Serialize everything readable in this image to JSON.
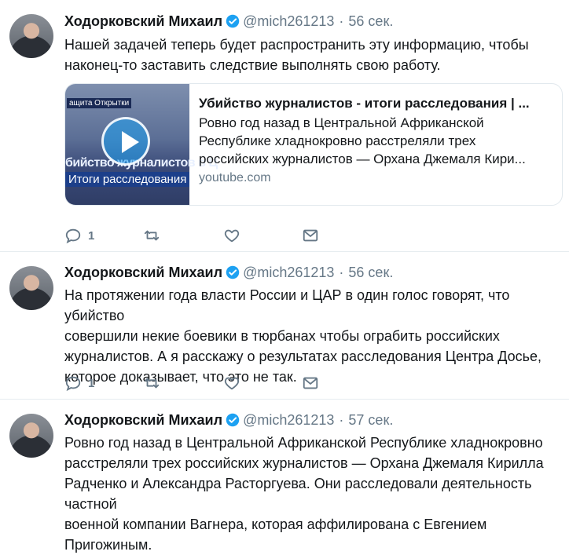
{
  "author": {
    "name": "Ходорковский Михаил",
    "handle": "@mich261213"
  },
  "tweets": [
    {
      "time": "56 сек.",
      "lines": [
        "Нашей задачей теперь будет распространить эту информацию, чтобы",
        "наконец-то заставить следствие выполнять свою работу."
      ],
      "card": {
        "title": "Убийство журналистов - итоги расследования | ...",
        "desc_lines": [
          "Ровно год назад в Центральной Африканской",
          "Республике хладнокровно расстреляли трех",
          "российских журналистов — Орхана Джемаля Кири..."
        ],
        "domain": "youtube.com",
        "thumb_tag": "ащита Открытки",
        "thumb_text": "бийство журналистов в Ц",
        "thumb_banner": "Итоги расследования"
      },
      "replies": "1"
    },
    {
      "time": "56 сек.",
      "lines": [
        "На протяжении года власти России и ЦАР в один голос говорят, что убийство",
        "совершили некие боевики в тюрбанах чтобы ограбить российских",
        "журналистов. А я расскажу о результатах расследования Центра Досье,",
        "которое доказывает, что это не так."
      ],
      "replies": "1"
    },
    {
      "time": "57 сек.",
      "lines": [
        "Ровно год назад в Центральной Африканской Республике хладнокровно",
        "расстреляли трех российских журналистов — Орхана Джемаля Кирилла",
        "Радченко и Александра Расторгуева. Они расследовали деятельность частной",
        "военной компании Вагнера, которая аффилирована с Евгением Пригожиным."
      ]
    }
  ],
  "separator": "·",
  "colors": {
    "verified": "#1da1f2",
    "meta": "#657786",
    "text": "#14171a",
    "divider": "#e6ecf0"
  },
  "icons": [
    "reply-icon",
    "retweet-icon",
    "like-icon",
    "direct-message-icon",
    "verified-badge-icon",
    "play-icon"
  ]
}
